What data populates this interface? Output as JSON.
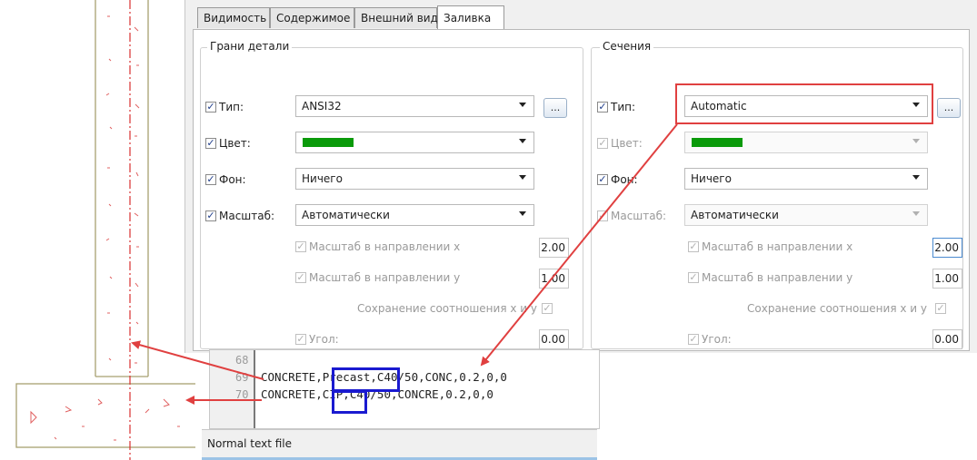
{
  "tabs": [
    {
      "label": "Видимость"
    },
    {
      "label": "Содержимое"
    },
    {
      "label": "Внешний вид"
    },
    {
      "label": "Заливка"
    }
  ],
  "left_group": {
    "title": "Грани детали",
    "type_label": "Тип:",
    "type_value": "ANSI32",
    "color_label": "Цвет:",
    "background_label": "Фон:",
    "background_value": "Ничего",
    "scale_label": "Масштаб:",
    "scale_value": "Автоматически",
    "scale_x_label": "Масштаб в направлении x",
    "scale_x_value": "2.00",
    "scale_y_label": "Масштаб в направлении y",
    "scale_y_value": "1.00",
    "keep_ratio_label": "Сохранение соотношения x и y",
    "angle_label": "Угол:",
    "angle_value": "0.00",
    "dots_label": "...",
    "color": "#0a9a0a"
  },
  "right_group": {
    "title": "Сечения",
    "type_label": "Тип:",
    "type_value": "Automatic",
    "color_label": "Цвет:",
    "background_label": "Фон:",
    "background_value": "Ничего",
    "scale_label": "Масштаб:",
    "scale_value": "Автоматически",
    "scale_x_label": "Масштаб в направлении x",
    "scale_x_value": "2.00",
    "scale_y_label": "Масштаб в направлении y",
    "scale_y_value": "1.00",
    "keep_ratio_label": "Сохранение соотношения x и y",
    "angle_label": "Угол:",
    "angle_value": "0.00",
    "dots_label": "...",
    "color": "#0a9a0a"
  },
  "editor": {
    "lines": [
      {
        "number": "68",
        "text": ""
      },
      {
        "number": "69",
        "text": "CONCRETE,Precast,C40/50,CONC,0.2,0,0"
      },
      {
        "number": "70",
        "text": "CONCRETE,CIP,C40/50,CONCRE,0.2,0,0"
      }
    ],
    "highlight_precast": "Precast",
    "highlight_cip": "CIP"
  },
  "statusbar": {
    "text": "Normal text file"
  },
  "colors": {
    "red_annotation": "#e04040",
    "blue_annotation": "#1a1ad0",
    "cad_axis": "#d83030"
  }
}
